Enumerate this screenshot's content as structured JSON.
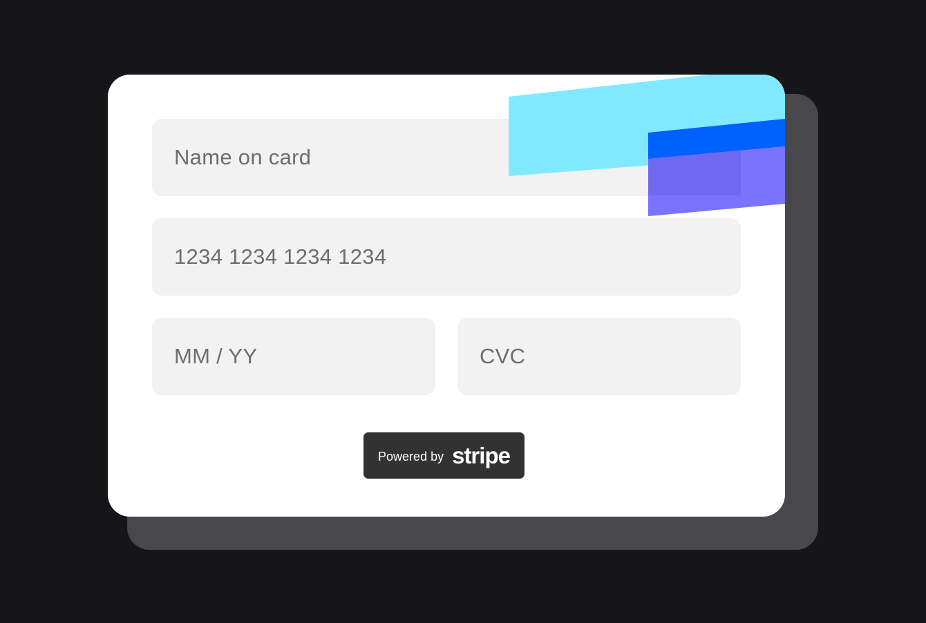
{
  "form": {
    "name_placeholder": "Name on card",
    "number_placeholder": "1234 1234 1234 1234",
    "expiry_placeholder": "MM / YY",
    "cvc_placeholder": "CVC"
  },
  "badge": {
    "prefix": "Powered by",
    "logo": "stripe"
  },
  "colors": {
    "background": "#161618",
    "shadow_card": "#48484a",
    "card": "#ffffff",
    "field": "#f2f2f2",
    "placeholder_text": "#6d6d6d",
    "decor_cyan": "#80e9ff",
    "decor_blue": "#0061ff",
    "decor_purple": "#7a73ff",
    "badge_bg": "#323232"
  }
}
